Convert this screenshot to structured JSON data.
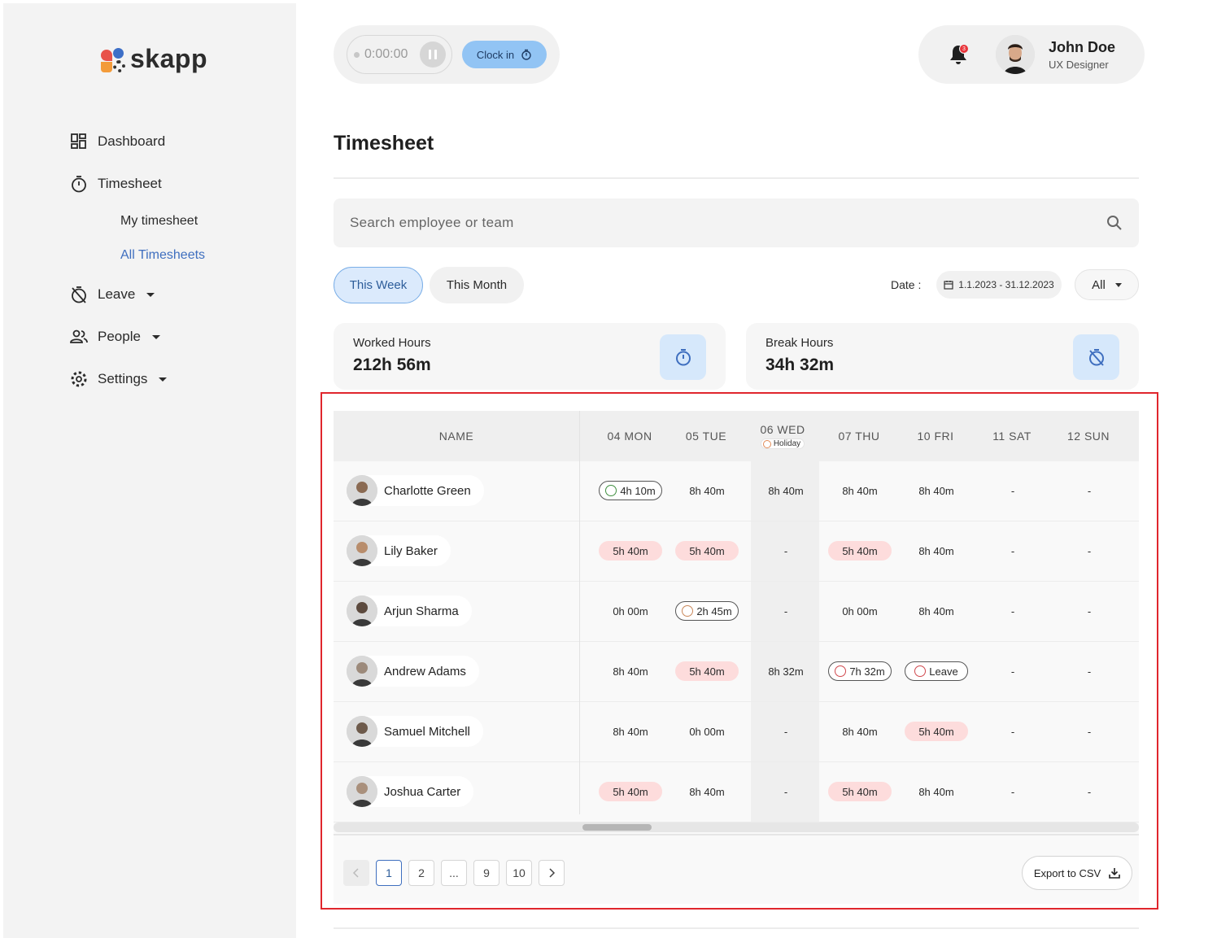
{
  "app": {
    "logo_text": "skapp"
  },
  "sidebar": {
    "items": [
      {
        "label": "Dashboard",
        "icon": "dashboard-icon"
      },
      {
        "label": "Timesheet",
        "icon": "stopwatch-icon"
      },
      {
        "label": "Leave",
        "icon": "leave-icon"
      },
      {
        "label": "People",
        "icon": "people-icon"
      },
      {
        "label": "Settings",
        "icon": "gear-icon"
      }
    ],
    "sub_items": [
      {
        "label": "My timesheet",
        "active": false
      },
      {
        "label": "All Timesheets",
        "active": true
      }
    ]
  },
  "topbar": {
    "timer": "0:00:00",
    "clock_in_label": "Clock in",
    "notification_count": "3",
    "user": {
      "name": "John Doe",
      "role": "UX Designer"
    }
  },
  "page": {
    "title": "Timesheet",
    "search_placeholder": "Search employee or team",
    "filters": {
      "this_week": "This Week",
      "this_month": "This Month"
    },
    "date_label": "Date :",
    "date_range": "1.1.2023 - 31.12.2023",
    "scope": "All"
  },
  "stats": {
    "worked": {
      "label": "Worked Hours",
      "value": "212h 56m"
    },
    "break": {
      "label": "Break Hours",
      "value": "34h 32m"
    }
  },
  "table": {
    "name_header": "NAME",
    "days": [
      "04 MON",
      "05 TUE",
      "06 WED",
      "07 THU",
      "10 FRI",
      "11 SAT",
      "12 SUN"
    ],
    "holiday_label": "Holiday",
    "rows": [
      {
        "name": "Charlotte Green",
        "cells": [
          {
            "text": "4h 10m",
            "style": "outline",
            "icon": "palm-tree-icon"
          },
          {
            "text": "8h 40m",
            "style": "plain"
          },
          {
            "text": "8h 40m",
            "style": "plain"
          },
          {
            "text": "8h 40m",
            "style": "plain"
          },
          {
            "text": "8h 40m",
            "style": "plain"
          },
          {
            "text": "-",
            "style": "plain"
          },
          {
            "text": "-",
            "style": "plain"
          }
        ]
      },
      {
        "name": "Lily Baker",
        "cells": [
          {
            "text": "5h 40m",
            "style": "red"
          },
          {
            "text": "5h 40m",
            "style": "red"
          },
          {
            "text": "-",
            "style": "plain"
          },
          {
            "text": "5h 40m",
            "style": "red"
          },
          {
            "text": "8h 40m",
            "style": "plain"
          },
          {
            "text": "-",
            "style": "plain"
          },
          {
            "text": "-",
            "style": "plain"
          }
        ]
      },
      {
        "name": "Arjun Sharma",
        "cells": [
          {
            "text": "0h 00m",
            "style": "plain"
          },
          {
            "text": "2h 45m",
            "style": "outline",
            "icon": "sick-icon"
          },
          {
            "text": "-",
            "style": "plain"
          },
          {
            "text": "0h 00m",
            "style": "plain"
          },
          {
            "text": "8h 40m",
            "style": "plain"
          },
          {
            "text": "-",
            "style": "plain"
          },
          {
            "text": "-",
            "style": "plain"
          }
        ]
      },
      {
        "name": "Andrew Adams",
        "cells": [
          {
            "text": "8h 40m",
            "style": "plain"
          },
          {
            "text": "5h 40m",
            "style": "red"
          },
          {
            "text": "8h 32m",
            "style": "plain"
          },
          {
            "text": "7h 32m",
            "style": "outline",
            "icon": "calendar-icon"
          },
          {
            "text": "Leave",
            "style": "outline",
            "icon": "leave-icon"
          },
          {
            "text": "-",
            "style": "plain"
          },
          {
            "text": "-",
            "style": "plain"
          }
        ]
      },
      {
        "name": "Samuel Mitchell",
        "cells": [
          {
            "text": "8h 40m",
            "style": "plain"
          },
          {
            "text": "0h 00m",
            "style": "plain"
          },
          {
            "text": "-",
            "style": "plain"
          },
          {
            "text": "8h 40m",
            "style": "plain"
          },
          {
            "text": "5h 40m",
            "style": "red"
          },
          {
            "text": "-",
            "style": "plain"
          },
          {
            "text": "-",
            "style": "plain"
          }
        ]
      },
      {
        "name": "Joshua Carter",
        "cells": [
          {
            "text": "5h 40m",
            "style": "red"
          },
          {
            "text": "8h 40m",
            "style": "plain"
          },
          {
            "text": "-",
            "style": "plain"
          },
          {
            "text": "5h 40m",
            "style": "red"
          },
          {
            "text": "8h 40m",
            "style": "plain"
          },
          {
            "text": "-",
            "style": "plain"
          },
          {
            "text": "-",
            "style": "plain"
          }
        ]
      }
    ]
  },
  "pagination": {
    "pages": [
      "1",
      "2",
      "...",
      "9",
      "10"
    ],
    "current": "1",
    "export_label": "Export to CSV"
  },
  "colors": {
    "accent": "#3f6fbf",
    "highlight": "#e0262d",
    "red_cell": "#fddcdc",
    "clock_in": "#92c4f4"
  }
}
